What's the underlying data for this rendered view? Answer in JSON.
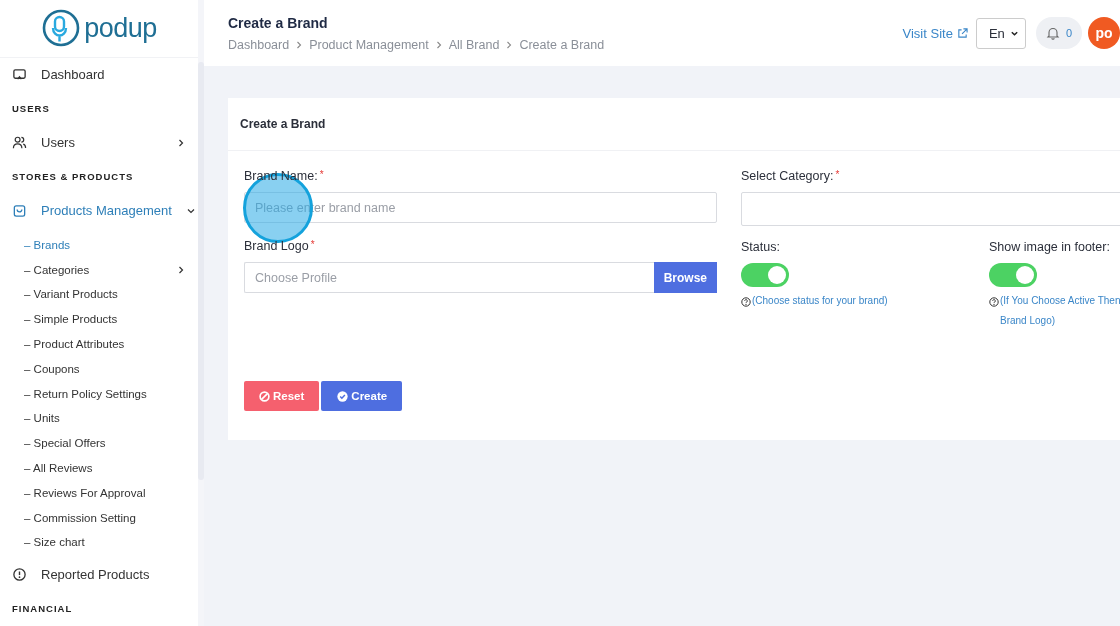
{
  "logo": {
    "text": "podup"
  },
  "sidebar": {
    "items": [
      {
        "kind": "link",
        "label": "Dashboard",
        "selected": false
      },
      {
        "kind": "section",
        "label": "USERS"
      },
      {
        "kind": "link",
        "label": "Users",
        "selected": false,
        "expanded": false
      },
      {
        "kind": "section",
        "label": "STORES & PRODUCTS"
      },
      {
        "kind": "link",
        "label": "Products Management",
        "selected": true,
        "expanded": true,
        "children": [
          {
            "label": "– Brands",
            "selected": true
          },
          {
            "label": "– Categories",
            "selected": false,
            "expanded": false
          },
          {
            "label": "– Variant Products",
            "selected": false
          },
          {
            "label": "– Simple Products",
            "selected": false
          },
          {
            "label": "– Product Attributes",
            "selected": false
          },
          {
            "label": "– Coupons",
            "selected": false
          },
          {
            "label": "– Return Policy Settings",
            "selected": false
          },
          {
            "label": "– Units",
            "selected": false
          },
          {
            "label": "– Special Offers",
            "selected": false
          },
          {
            "label": "– All Reviews",
            "selected": false
          },
          {
            "label": "– Reviews For Approval",
            "selected": false
          },
          {
            "label": "– Commission Setting",
            "selected": false
          },
          {
            "label": "– Size chart",
            "selected": false
          }
        ]
      },
      {
        "kind": "link",
        "label": "Reported Products",
        "selected": false
      },
      {
        "kind": "section",
        "label": "FINANCIAL"
      }
    ]
  },
  "header": {
    "title": "Create a Brand",
    "breadcrumbs": [
      "Dashboard",
      "Product Management",
      "All Brand",
      "Create a Brand"
    ],
    "visit_site": "Visit Site",
    "language": "En",
    "notifications": "0",
    "avatar": "po"
  },
  "card": {
    "title": "Create a Brand",
    "brand_name": {
      "label": "Brand Name:",
      "asterisk": "*",
      "placeholder": "Please enter brand name",
      "click_highlight": true
    },
    "brand_logo": {
      "label": "Brand Logo",
      "asterisk": "*",
      "placeholder": "Choose Profile",
      "button": "Browse"
    },
    "category": {
      "label": "Select Category:",
      "asterisk": "*"
    },
    "toggles": [
      {
        "label": "Status:",
        "on": true,
        "hint_lines": [
          "(Choose status for your brand)"
        ]
      },
      {
        "label": "Show image in footer:",
        "on": true,
        "hint_lines": [
          "(If You Choose Active Then",
          "Brand Logo)"
        ]
      }
    ],
    "buttons": [
      {
        "kind": "reset",
        "label": "Reset"
      },
      {
        "kind": "create",
        "label": "Create"
      }
    ]
  }
}
